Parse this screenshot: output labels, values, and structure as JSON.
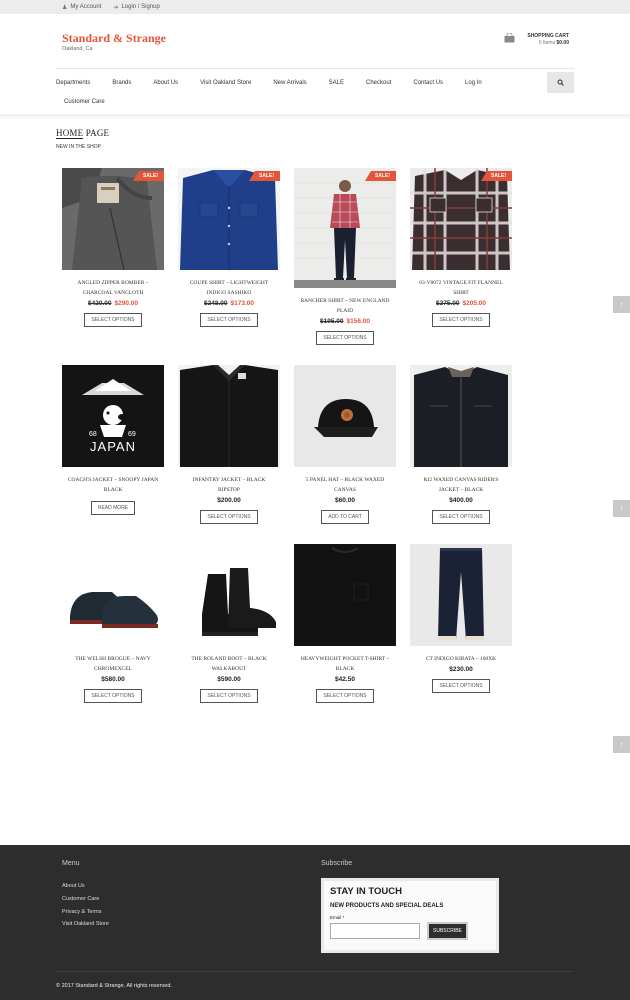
{
  "topbar": {
    "my_account": "My Account",
    "login": "Login / Signup"
  },
  "header": {
    "logo": "Standard & Strange",
    "tagline": "Oakland, Ca",
    "cart_title": "SHOPPING CART",
    "cart_items": "0 Items",
    "cart_total": "$0.00"
  },
  "nav": {
    "items": [
      "Departments",
      "Brands",
      "About Us",
      "Visit Oakland Store",
      "New Arrivals",
      "SALE",
      "Checkout",
      "Contact Us",
      "Log In"
    ],
    "row2": "Customer Care"
  },
  "main": {
    "title_home": "HOME",
    "title_rest": " PAGE",
    "section": "NEW IN THE SHOP"
  },
  "products": [
    {
      "name": "ANGLED ZIPPER BOMBER – CHARCOAL VANCLOTH",
      "old": "$420.00",
      "new": "$290.00",
      "button": "SELECT OPTIONS",
      "sale": "SALE!"
    },
    {
      "name": "COUPE SHIRT – LIGHTWEIGHT INDIGO SASHIKO",
      "old": "$248.00",
      "new": "$173.00",
      "button": "SELECT OPTIONS",
      "sale": "SALE!"
    },
    {
      "name": "RANCHER SHIRT – NEW ENGLAND PLAID",
      "old": "$195.00",
      "new": "$156.00",
      "button": "SELECT OPTIONS",
      "sale": "SALE!"
    },
    {
      "name": "03-V8072 VINTAGE FIT FLANNEL SHIRT",
      "old": "$275.00",
      "new": "$205.00",
      "button": "SELECT OPTIONS",
      "sale": "SALE!"
    },
    {
      "name": "COACH'S JACKET – SNOOPY JAPAN BLACK",
      "price": "",
      "button": "READ MORE"
    },
    {
      "name": "INFANTRY JACKET – BLACK RIPSTOP",
      "price": "$200.00",
      "button": "SELECT OPTIONS"
    },
    {
      "name": "5 PANEL HAT – BLACK WAXED CANVAS",
      "price": "$60.00",
      "button": "ADD TO CART"
    },
    {
      "name": "RJ2 WAXED CANVAS RIDER'S JACKET – BLACK",
      "price": "$400.00",
      "button": "SELECT OPTIONS"
    },
    {
      "name": "THE WELSH BROGUE – NAVY CHROMEXCEL",
      "price": "$580.00",
      "button": "SELECT OPTIONS"
    },
    {
      "name": "THE ROLAND BOOT – BLACK WALKABOUT",
      "price": "$590.00",
      "button": "SELECT OPTIONS"
    },
    {
      "name": "HEAVYWEIGHT POCKET T-SHIRT – BLACK",
      "price": "$42.50",
      "button": "SELECT OPTIONS"
    },
    {
      "name": "CT INDIGO KIBATA – 100XK",
      "price": "$230.00",
      "button": "SELECT OPTIONS"
    }
  ],
  "art": {
    "japan_text": "JAPAN",
    "num_left": "68",
    "num_right": "69"
  },
  "footer": {
    "menu_title": "Menu",
    "menu": [
      "About Us",
      "Customer Care",
      "Privacy & Terms",
      "Visit Oakland Store"
    ],
    "subscribe_title": "Subscribe",
    "nl_title": "STAY IN TOUCH",
    "nl_sub": "NEW PRODUCTS AND SPECIAL DEALS",
    "nl_email": "Email *",
    "nl_button": "SUBSCRIBE",
    "copyright": "© 2017 Standard & Strange. All rights reserved."
  },
  "colors": {
    "accent": "#e4553a",
    "footer_bg": "#2d2d2d"
  }
}
